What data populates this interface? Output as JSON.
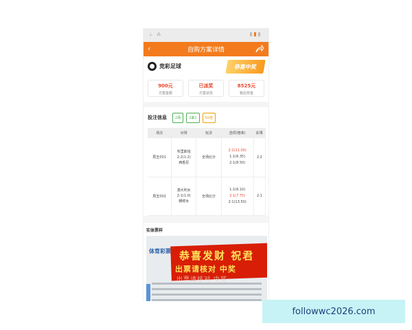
{
  "statusbar": {
    "left_text": "⊥ ⁂",
    "right_text": "▮"
  },
  "navbar": {
    "back": "‹",
    "title": "自购方案详情",
    "share_icon": "share-icon"
  },
  "header": {
    "lottery_name": "竞彩足球",
    "stamp_text": "恭喜中奖"
  },
  "summary": [
    {
      "value": "900元",
      "label": "方案金额"
    },
    {
      "value": "已派奖",
      "label": "方案状态"
    },
    {
      "value": "8525元",
      "label": "税后奖金"
    }
  ],
  "bet_info": {
    "title": "投注信息",
    "tags": [
      "2场",
      "2串1",
      "50倍"
    ]
  },
  "table": {
    "headers": [
      "场次",
      "对阵",
      "玩法",
      "选项(赔率)",
      "彩果"
    ],
    "rows": [
      {
        "match": "周五001",
        "home": "布里斯班",
        "score": "2:2(1:2)",
        "away": "西悉尼",
        "play": "全场比分",
        "options": [
          "2:2(11.00)",
          "1:1(6.35)",
          "2:1(8.50)"
        ],
        "result": "2:2"
      },
      {
        "match": "周五002",
        "home": "澳大利女",
        "score": "2:1(1:0)",
        "away": "朝鲜女",
        "play": "全场比分",
        "options": [
          "1:1(6.10)",
          "2:1(7.75)",
          "2:1(13.50)"
        ],
        "result": "2:1"
      }
    ]
  },
  "ticket": {
    "title": "实体票样",
    "banner_line1": "恭喜发财 祝君",
    "banner_line2": "出票请核对 中奖",
    "banner_line3": "出票请核对 中奖",
    "logo_text": "体育彩票"
  },
  "watermark": "followwc2026.com",
  "colors": {
    "accent": "#f37b1d",
    "prize_red": "#e8462b",
    "ticket_red": "#d81e06"
  }
}
